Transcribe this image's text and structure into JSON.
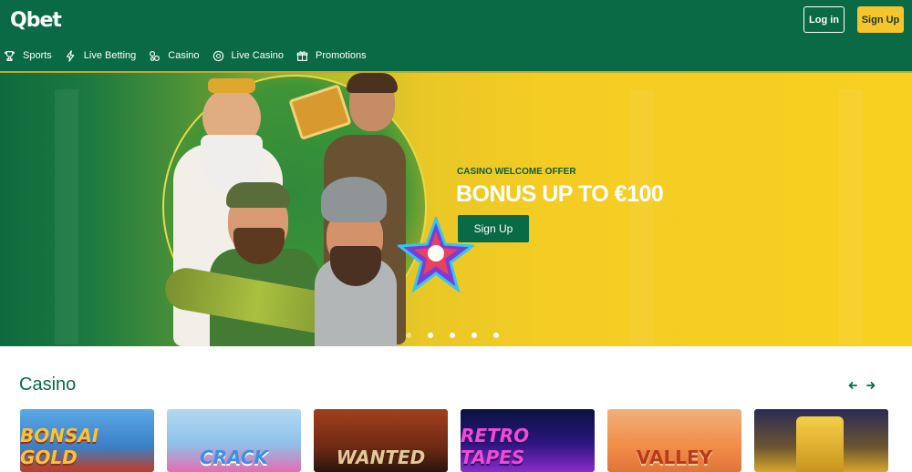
{
  "brand": {
    "logo": "Qbet"
  },
  "header": {
    "login_label": "Log in",
    "signup_label": "Sign Up"
  },
  "nav": {
    "items": [
      {
        "label": "Sports",
        "icon": "trophy-icon"
      },
      {
        "label": "Live Betting",
        "icon": "lightning-icon"
      },
      {
        "label": "Casino",
        "icon": "dice-icon"
      },
      {
        "label": "Live Casino",
        "icon": "chip-icon"
      },
      {
        "label": "Promotions",
        "icon": "gift-icon"
      }
    ]
  },
  "hero": {
    "kicker": "CASINO WELCOME OFFER",
    "title": "BONUS UP TO €100",
    "cta_label": "Sign Up",
    "slides_count": 5,
    "active_slide": 1
  },
  "casino": {
    "title": "Casino",
    "games": [
      {
        "title": "BONSAI GOLD"
      },
      {
        "title": "CRACK"
      },
      {
        "title": "WANTED"
      },
      {
        "title": "RETRO TAPES"
      },
      {
        "title": "VALLEY"
      },
      {
        "title": ""
      }
    ]
  },
  "colors": {
    "brand_green": "#0a6a45",
    "accent_yellow": "#f7c52b"
  }
}
